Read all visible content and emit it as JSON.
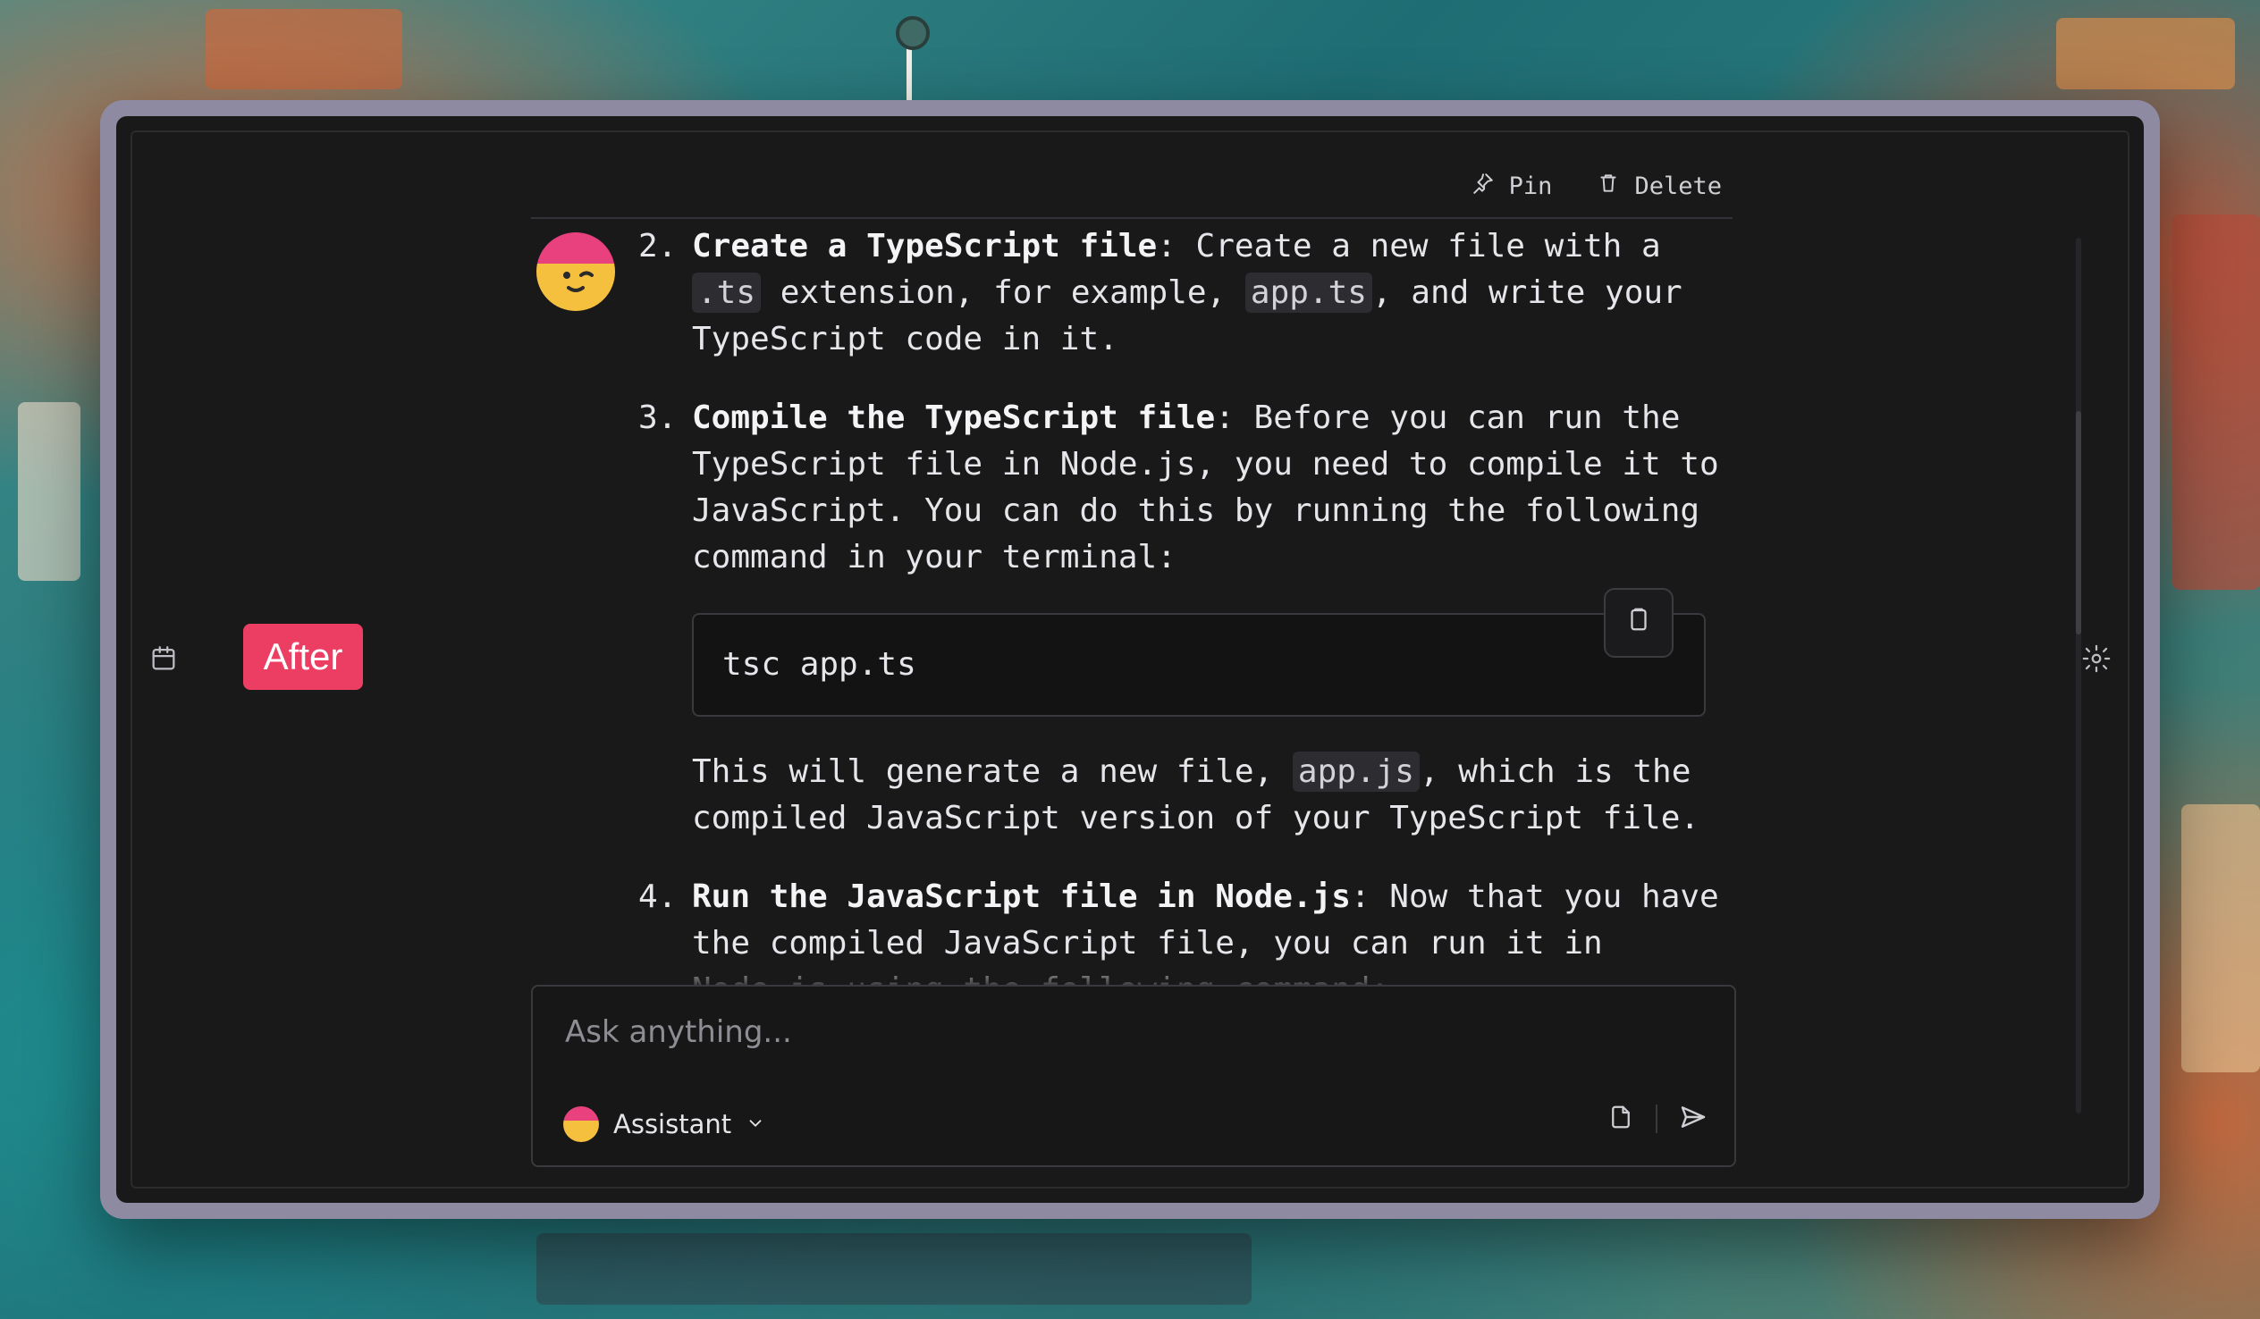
{
  "toolbar": {
    "pin_label": "Pin",
    "delete_label": "Delete"
  },
  "badge": {
    "label": "After"
  },
  "messages": {
    "item2": {
      "num": "2.",
      "title": "Create a TypeScript file",
      "text_a": ": Create a new file with a ",
      "code_a": ".ts",
      "text_b": " extension, for example, ",
      "code_b": "app.ts",
      "text_c": ", and write your TypeScript code in it."
    },
    "item3": {
      "num": "3.",
      "title": "Compile the TypeScript file",
      "text": ": Before you can run the TypeScript file in Node.js, you need to compile it to JavaScript. You can do this by running the following command in your terminal:"
    },
    "code_block": "tsc app.ts",
    "after_code": {
      "text_a": "This will generate a new file, ",
      "code": "app.js",
      "text_b": ", which is the compiled JavaScript version of your TypeScript file."
    },
    "item4": {
      "num": "4.",
      "title": "Run the JavaScript file in Node.js",
      "text": ": Now that you have the compiled JavaScript file, you can run it in Node.js using the following command:"
    }
  },
  "input": {
    "placeholder": "Ask anything..."
  },
  "assistant": {
    "label": "Assistant"
  },
  "colors": {
    "accent": "#ec3e63",
    "panel": "#19191a",
    "frame": "#8e8aa2"
  }
}
